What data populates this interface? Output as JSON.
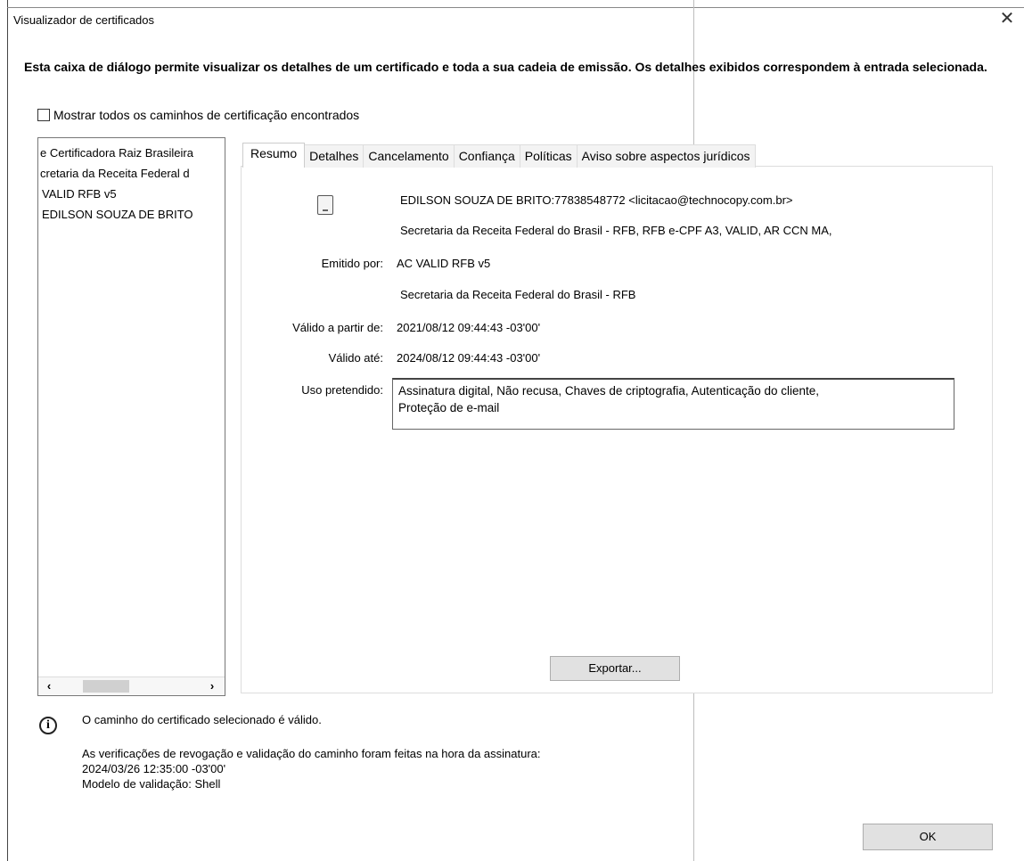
{
  "window": {
    "title": "Visualizador de certificados",
    "close_glyph": "✕"
  },
  "intro_text": "Esta caixa de diálogo permite visualizar os detalhes de um certificado e toda a sua cadeia de emissão. Os detalhes exibidos correspondem à entrada selecionada.",
  "show_all_paths": {
    "label": "Mostrar todos os caminhos de certificação encontrados",
    "checked": false
  },
  "chain_tree": {
    "items": [
      {
        "label": "e Certificadora Raiz Brasileira"
      },
      {
        "label": "cretaria da Receita Federal d"
      },
      {
        "label": "VALID RFB v5"
      },
      {
        "label": "EDILSON SOUZA DE BRITO"
      }
    ],
    "scroll_left": "‹",
    "scroll_right": "›"
  },
  "tabs": [
    {
      "label": "Resumo",
      "active": true
    },
    {
      "label": "Detalhes",
      "active": false
    },
    {
      "label": "Cancelamento",
      "active": false
    },
    {
      "label": "Confiança",
      "active": false
    },
    {
      "label": "Políticas",
      "active": false
    },
    {
      "label": "Aviso sobre aspectos jurídicos",
      "active": false
    }
  ],
  "summary": {
    "subject_name": "EDILSON SOUZA DE BRITO:77838548772 <licitacao@technocopy.com.br>",
    "subject_org": "Secretaria da Receita Federal do Brasil - RFB, RFB e-CPF A3, VALID, AR CCN MA,",
    "issued_by_label": "Emitido por:",
    "issued_by_value": "AC VALID RFB v5",
    "issued_by_org": "Secretaria da Receita Federal do Brasil - RFB",
    "valid_from_label": "Válido a partir de:",
    "valid_from_value": "2021/08/12 09:44:43 -03'00'",
    "valid_to_label": "Válido até:",
    "valid_to_value": "2024/08/12 09:44:43 -03'00'",
    "usage_label": "Uso pretendido:",
    "usage_value_line1": "Assinatura digital, Não recusa, Chaves de criptografia, Autenticação do cliente,",
    "usage_value_line2": "Proteção de e-mail",
    "export_button": "Exportar..."
  },
  "status": {
    "icon": "info-icon",
    "message": "O caminho do certificado selecionado é válido.",
    "verification_line1": "As verificações de revogação e validação do caminho foram feitas na hora da assinatura:",
    "verification_line2": "2024/03/26 12:35:00 -03'00'",
    "verification_line3": "Modelo de validação: Shell"
  },
  "ok_button": "OK"
}
